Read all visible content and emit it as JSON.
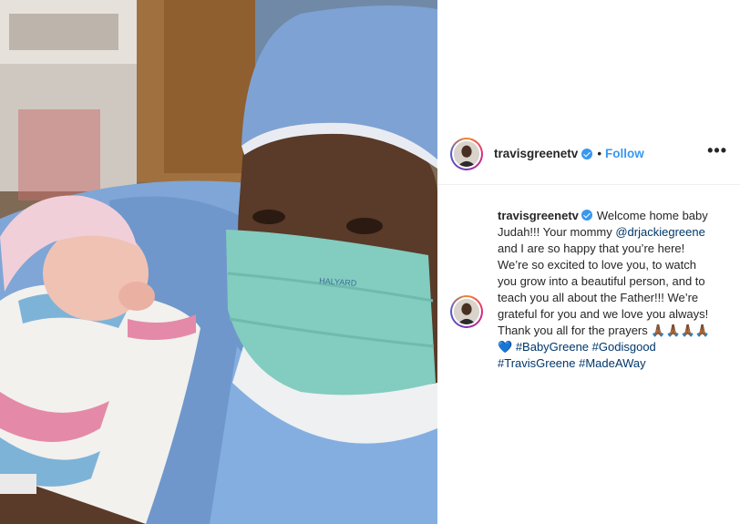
{
  "post": {
    "username": "travisgreenetv",
    "follow_label": "Follow",
    "separator": "•",
    "more_label": "•••",
    "caption": {
      "username": "travisgreenetv",
      "text_1": "Welcome home baby Judah!!! Your mommy",
      "mention": "@drjackiegreene",
      "text_2": "and I are so happy that you’re here! We’re so excited to love you, to watch you grow into a beautiful person, and to teach you all about the Father!!! We’re grateful for you and we love you always! Thank you all for the prayers",
      "emoji": "🙏🏾🙏🏾🙏🏾🙏🏾💙",
      "hashtags": [
        "#BabyGreene",
        "#Godisgood",
        "#TravisGreene",
        "#MadeAWay"
      ]
    },
    "mask_brand": "HALYARD"
  },
  "colors": {
    "accent": "#3897f0",
    "link": "#00376b",
    "text": "#262626"
  },
  "icons": {
    "verified": "verified-badge-icon",
    "more": "more-options-icon"
  }
}
